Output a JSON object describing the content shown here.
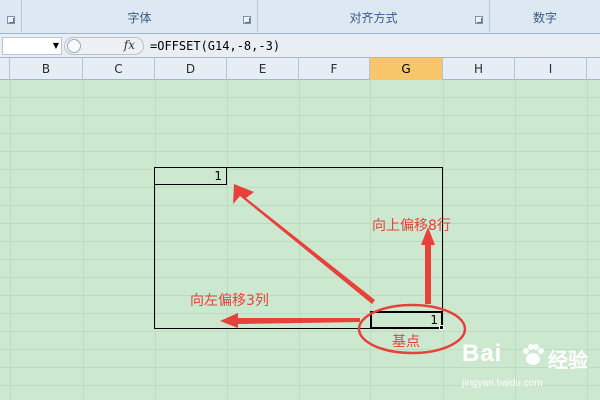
{
  "ribbon": {
    "groups": [
      {
        "label": ""
      },
      {
        "label": "字体"
      },
      {
        "label": "对齐方式"
      },
      {
        "label": "数字"
      }
    ]
  },
  "formula_bar": {
    "name_box_value": "",
    "fx_label": "fx",
    "formula": "=OFFSET(G14,-8,-3)"
  },
  "columns": [
    "B",
    "C",
    "D",
    "E",
    "F",
    "G",
    "H",
    "I"
  ],
  "selected_column": "G",
  "cells": {
    "result_value": "1",
    "base_value": "1"
  },
  "annotations": {
    "up_label": "向上偏移8行",
    "left_label": "向左偏移3列",
    "base_label": "基点"
  },
  "colors": {
    "sheet_background": "#cce8cf",
    "annotation_red": "#e8403a",
    "selected_column_header": "#f7c66a"
  },
  "watermark": {
    "brand": "Bai",
    "brand_suffix": "经验",
    "url": "jingyan.baidu.com"
  }
}
